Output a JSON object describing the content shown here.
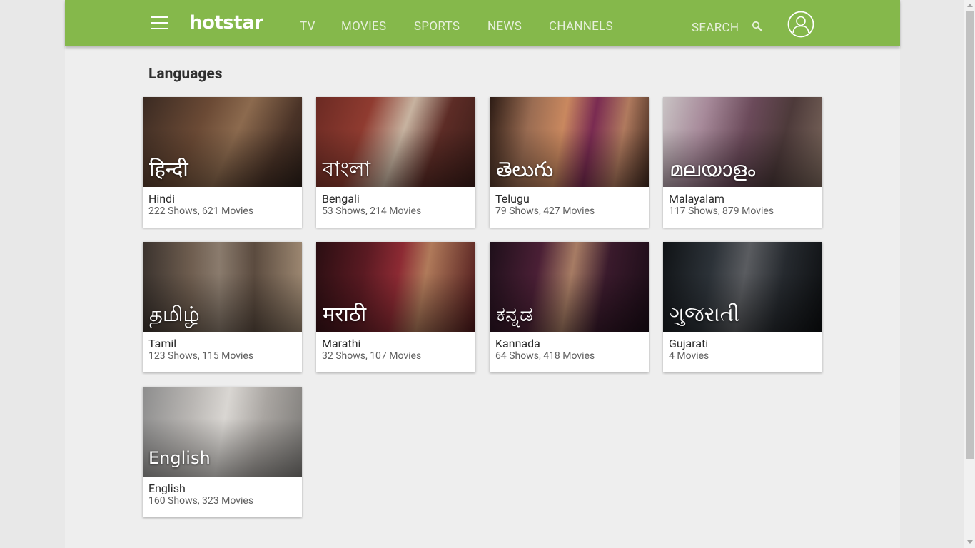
{
  "app": {
    "logo": "hotstar",
    "nav": [
      "TV",
      "MOVIES",
      "SPORTS",
      "NEWS",
      "CHANNELS"
    ],
    "search_label": "SEARCH",
    "accent_color": "#85b84b",
    "icons": {
      "menu": "hamburger-icon",
      "search": "search-icon",
      "profile": "user-avatar-icon"
    }
  },
  "page": {
    "title": "Languages",
    "languages": [
      {
        "native": "हिन्दी",
        "name": "Hindi",
        "count": "222 Shows, 621 Movies"
      },
      {
        "native": "বাংলা",
        "name": "Bengali",
        "count": "53 Shows, 214 Movies"
      },
      {
        "native": "తెలుగు",
        "name": "Telugu",
        "count": "79 Shows, 427 Movies"
      },
      {
        "native": "മലയാളം",
        "name": "Malayalam",
        "count": "117 Shows, 879 Movies"
      },
      {
        "native": "தமிழ்",
        "name": "Tamil",
        "count": "123 Shows, 115 Movies"
      },
      {
        "native": "मराठी",
        "name": "Marathi",
        "count": "32 Shows, 107 Movies"
      },
      {
        "native": "ಕನ್ನಡ",
        "name": "Kannada",
        "count": "64 Shows, 418 Movies"
      },
      {
        "native": "ગુજરાતી",
        "name": "Gujarati",
        "count": "4 Movies"
      },
      {
        "native": "English",
        "name": "English",
        "count": "160 Shows, 323 Movies"
      }
    ]
  }
}
